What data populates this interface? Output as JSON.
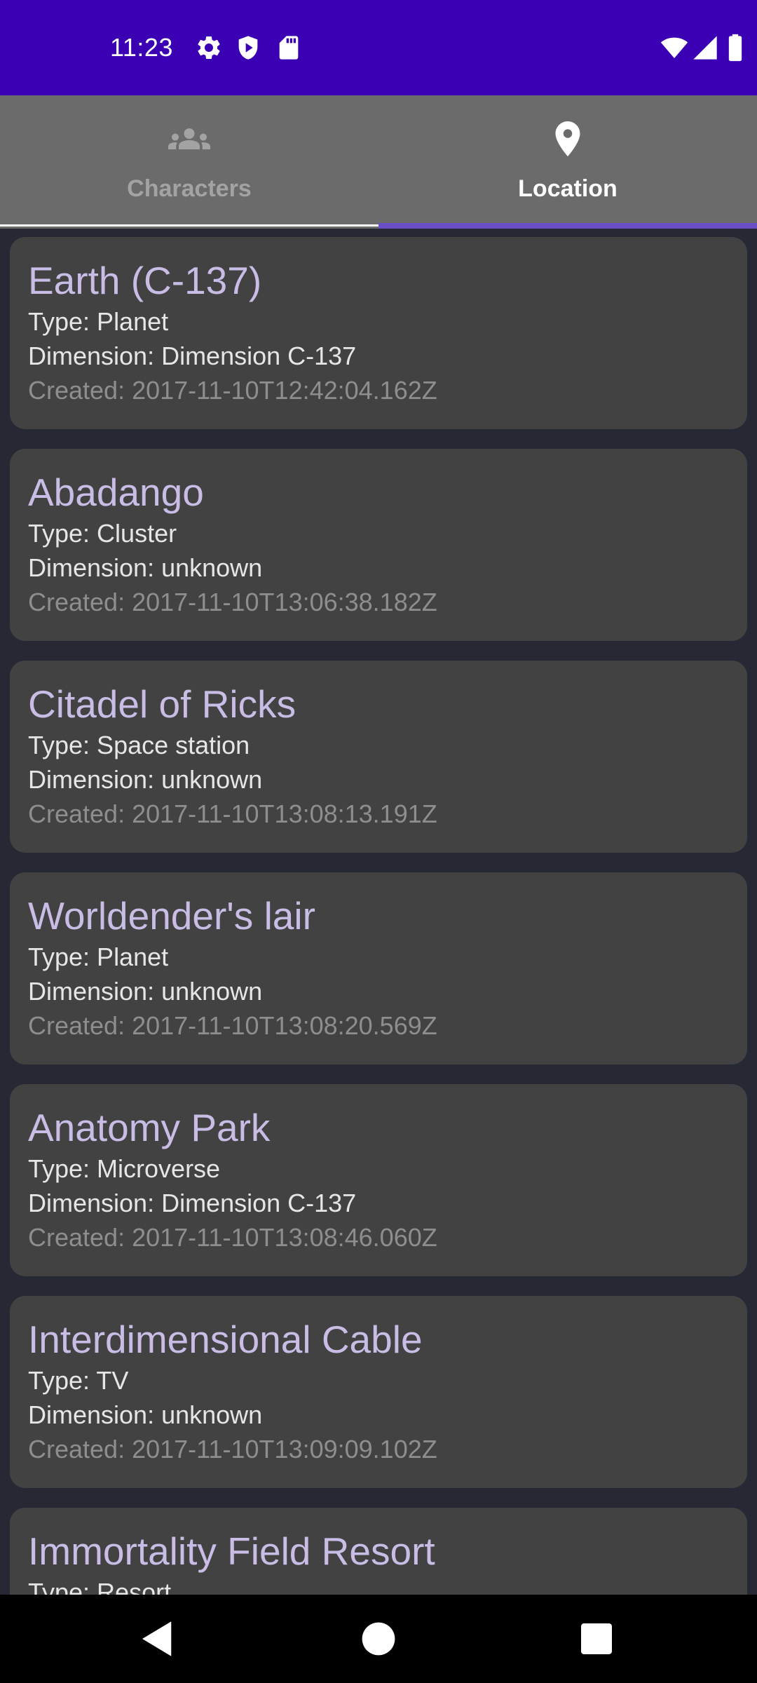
{
  "status_bar": {
    "time": "11:23",
    "icons": [
      "gear-icon",
      "shield-icon",
      "sd-card-icon",
      "wifi-icon",
      "signal-icon",
      "battery-icon"
    ],
    "background": "#3b00b3"
  },
  "tabs": [
    {
      "label": "Characters",
      "icon": "people-icon",
      "selected": false
    },
    {
      "label": "Location",
      "icon": "location-pin-icon",
      "selected": true
    }
  ],
  "locations": [
    {
      "name": "Earth (C-137)",
      "type": "Type: Planet",
      "dimension": "Dimension: Dimension C-137",
      "created": "Created: 2017-11-10T12:42:04.162Z"
    },
    {
      "name": "Abadango",
      "type": "Type: Cluster",
      "dimension": "Dimension: unknown",
      "created": "Created: 2017-11-10T13:06:38.182Z"
    },
    {
      "name": "Citadel of Ricks",
      "type": "Type: Space station",
      "dimension": "Dimension: unknown",
      "created": "Created: 2017-11-10T13:08:13.191Z"
    },
    {
      "name": "Worldender's lair",
      "type": "Type: Planet",
      "dimension": "Dimension: unknown",
      "created": "Created: 2017-11-10T13:08:20.569Z"
    },
    {
      "name": "Anatomy Park",
      "type": "Type: Microverse",
      "dimension": "Dimension: Dimension C-137",
      "created": "Created: 2017-11-10T13:08:46.060Z"
    },
    {
      "name": "Interdimensional Cable",
      "type": "Type: TV",
      "dimension": "Dimension: unknown",
      "created": "Created: 2017-11-10T13:09:09.102Z"
    },
    {
      "name": "Immortality Field Resort",
      "type": "Type: Resort"
    }
  ],
  "nav_bar": {
    "buttons": [
      "back-icon",
      "home-icon",
      "recents-icon"
    ]
  },
  "colors": {
    "accent": "#6a4fc7",
    "card_background": "#424242",
    "title_text": "#c9bde6",
    "screen_background": "#262834"
  }
}
